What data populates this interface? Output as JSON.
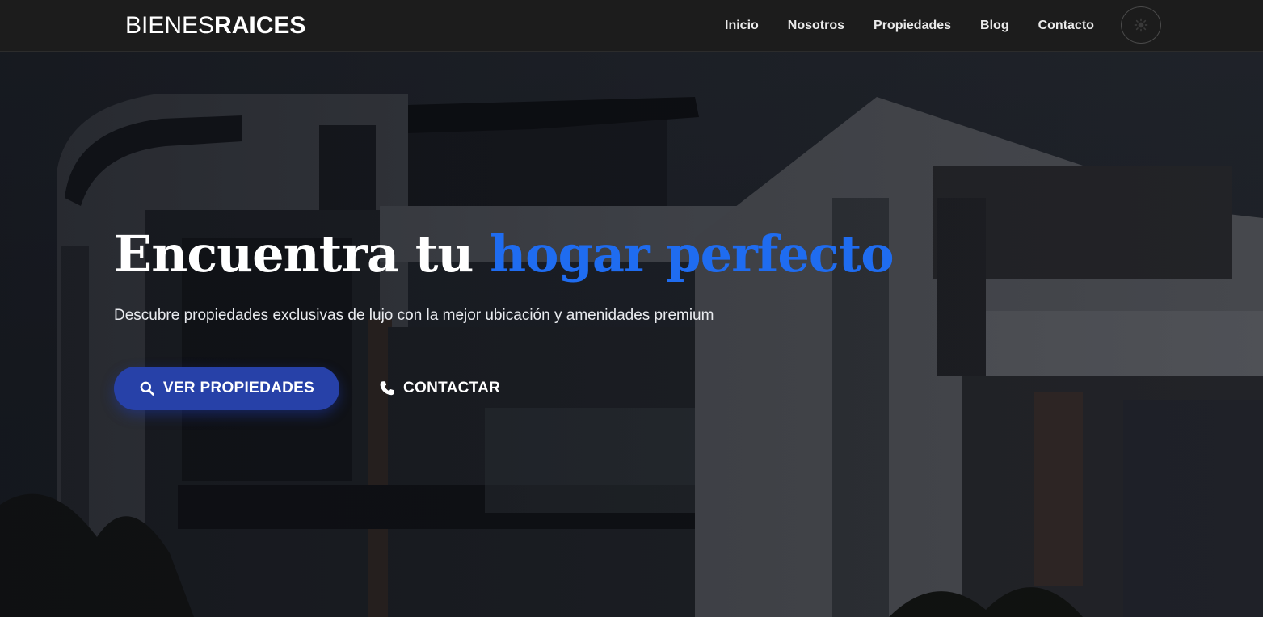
{
  "header": {
    "logo_light": "BIENES",
    "logo_bold": "RAICES",
    "nav": [
      {
        "label": "Inicio"
      },
      {
        "label": "Nosotros"
      },
      {
        "label": "Propiedades"
      },
      {
        "label": "Blog"
      },
      {
        "label": "Contacto"
      }
    ],
    "theme_toggle_icon": "sun-icon"
  },
  "hero": {
    "title_part1": "Encuentra tu ",
    "title_accent": "hogar perfecto",
    "subtitle": "Descubre propiedades exclusivas de lujo con la mejor ubicación y amenidades premium",
    "primary_button": {
      "label": "VER PROPIEDADES",
      "icon": "search-icon"
    },
    "secondary_button": {
      "label": "CONTACTAR",
      "icon": "phone-icon"
    },
    "background_image": "modern-house-photo"
  },
  "colors": {
    "accent": "#1f6cf0",
    "primary_button": "#2741a8",
    "header_bg": "#1c1c1c"
  }
}
